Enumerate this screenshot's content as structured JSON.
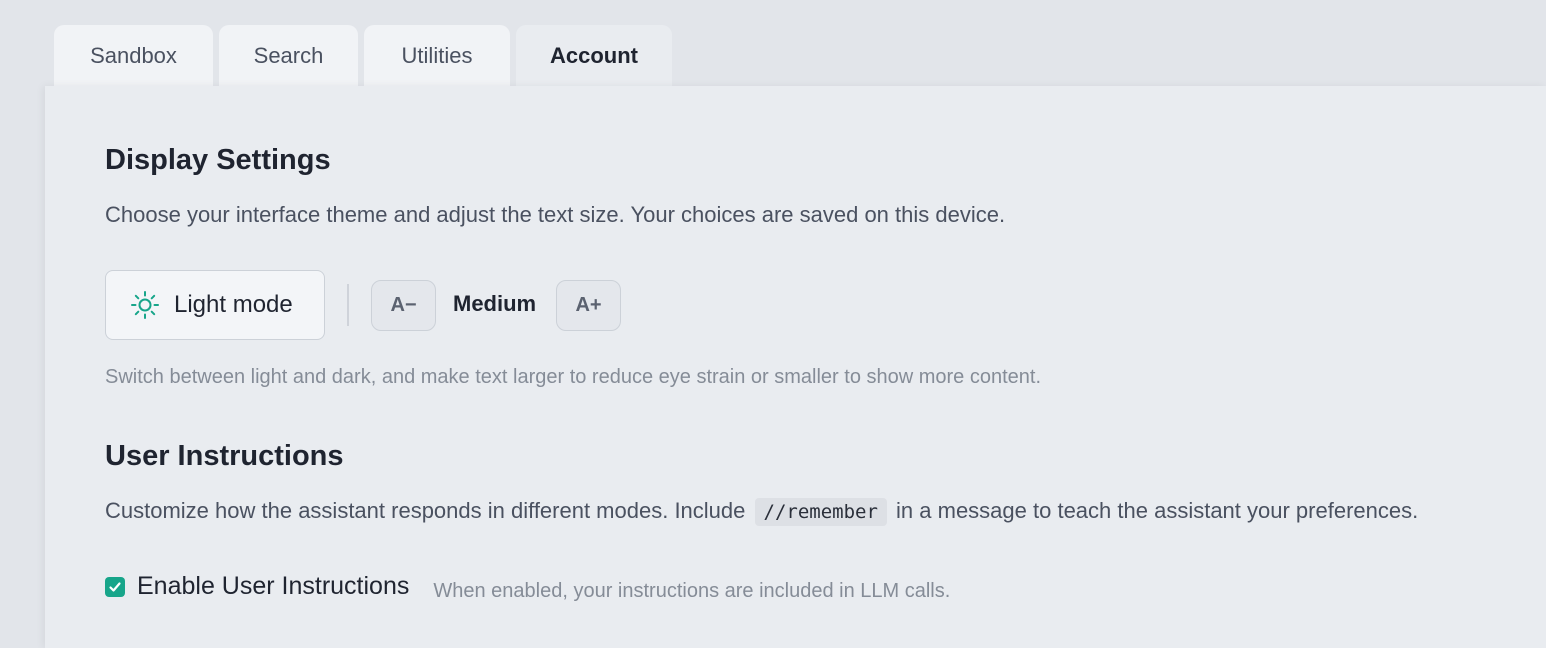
{
  "tabs": [
    {
      "label": "Sandbox"
    },
    {
      "label": "Search"
    },
    {
      "label": "Utilities"
    },
    {
      "label": "Account",
      "active": true
    }
  ],
  "display": {
    "title": "Display Settings",
    "description": "Choose your interface theme and adjust the text size. Your choices are saved on this device.",
    "theme_button_label": "Light mode",
    "theme_icon": "sun-icon",
    "decrease_label": "A−",
    "size_label": "Medium",
    "increase_label": "A+",
    "hint": "Switch between light and dark, and make text larger to reduce eye strain or smaller to show more content."
  },
  "instructions": {
    "title": "User Instructions",
    "description_before": "Customize how the assistant responds in different modes. Include",
    "code": "//remember",
    "description_after": "in a message to teach the assistant your preferences.",
    "enable_label": "Enable User Instructions",
    "enable_checked": true,
    "enable_hint": "When enabled, your instructions are included in LLM calls."
  },
  "colors": {
    "accent": "#17a58a",
    "panel_bg": "#e9ecf0",
    "page_bg": "#e2e5ea"
  }
}
